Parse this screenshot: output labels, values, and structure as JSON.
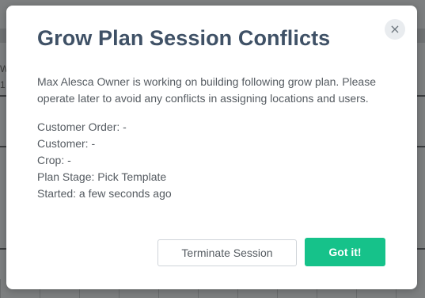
{
  "background": {
    "partial_text_1": "W",
    "partial_text_2": "1"
  },
  "modal": {
    "title": "Grow Plan Session Conflicts",
    "close_icon": "×",
    "description": "Max Alesca Owner is working on building following grow plan. Please operate later to avoid any conflicts in assigning locations and users.",
    "details": [
      "Customer Order: -",
      "Customer: -",
      "Crop: -",
      "Plan Stage: Pick Template",
      "Started: a few seconds ago"
    ],
    "terminate_label": "Terminate Session",
    "confirm_label": "Got it!"
  },
  "colors": {
    "title": "#3f5166",
    "primary_button": "#16c28a",
    "overlay": "#7d7f80"
  }
}
